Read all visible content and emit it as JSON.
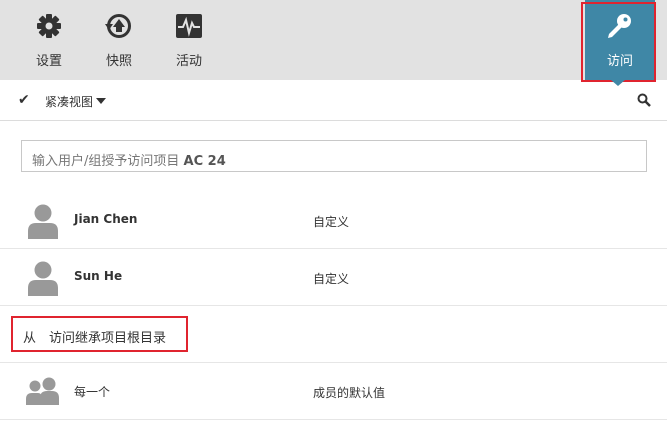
{
  "toolbar": {
    "settings_label": "设置",
    "snapshot_label": "快照",
    "activity_label": "活动",
    "access_label": "访问"
  },
  "viewbar": {
    "view_label": "紧凑视图"
  },
  "grant_input": {
    "placeholder_prefix": "输入用户/组授予访问项目",
    "placeholder_project": "AC 24"
  },
  "users": [
    {
      "name": "Jian Chen",
      "role": "自定义"
    },
    {
      "name": "Sun He",
      "role": "自定义"
    }
  ],
  "inherit": {
    "from_label": "从",
    "text": "访问继承项目根目录"
  },
  "everyone": {
    "name": "每一个",
    "role": "成员的默认值"
  },
  "colors": {
    "toolbar_bg": "#e2e2e2",
    "access_accent": "#3f87a6",
    "highlight_outline": "#e0242f"
  }
}
